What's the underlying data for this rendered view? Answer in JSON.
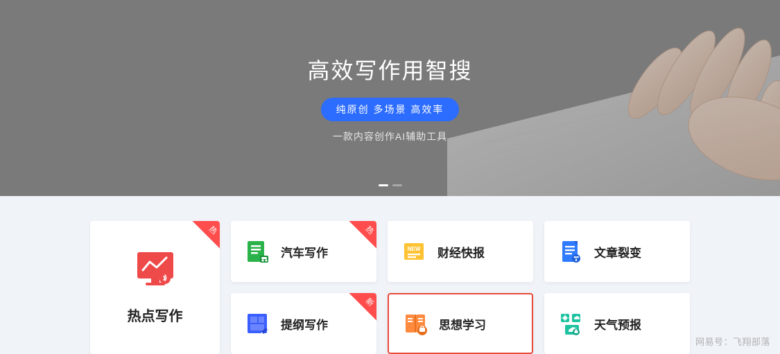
{
  "hero": {
    "title": "高效写作用智搜",
    "pill": "纯原创 多场景 高效率",
    "subtitle": "一款内容创作AI辅助工具"
  },
  "featured": {
    "label": "热点写作",
    "badge": "热",
    "icon": "chart-monitor-icon",
    "color": "#ef4a4a"
  },
  "cards": [
    {
      "label": "汽车写作",
      "badge": "热",
      "icon": "doc-green-icon",
      "color": "#2bb24b"
    },
    {
      "label": "财经快报",
      "badge": null,
      "icon": "new-tag-icon",
      "color": "#ffc233"
    },
    {
      "label": "文章裂变",
      "badge": null,
      "icon": "doc-blue-icon",
      "color": "#2f7bff"
    },
    {
      "label": "提纲写作",
      "badge": "新",
      "icon": "layout-blue-icon",
      "color": "#3b5fff"
    },
    {
      "label": "思想学习",
      "badge": null,
      "icon": "book-orange-icon",
      "color": "#ff8a3d",
      "highlight": true
    },
    {
      "label": "天气预报",
      "badge": null,
      "icon": "weather-icon",
      "color": "#1fc2a0"
    }
  ],
  "watermark": "网易号：飞翔部落"
}
